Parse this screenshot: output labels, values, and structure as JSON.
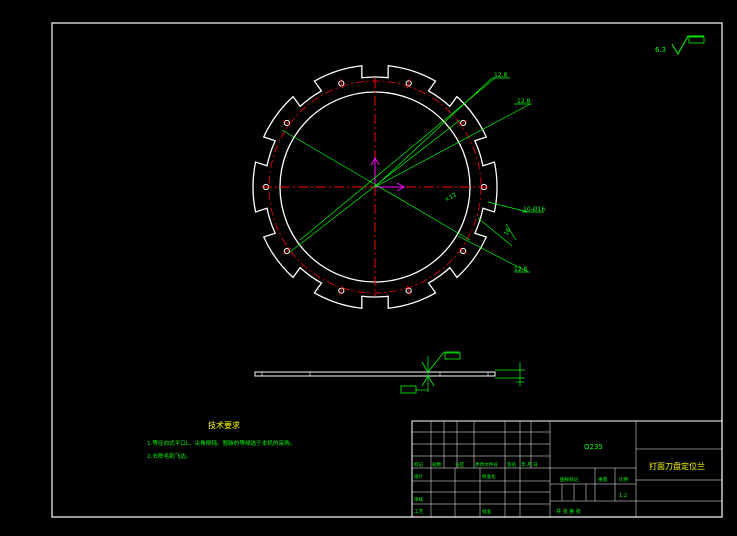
{
  "drawing": {
    "roughness_symbol": "6.3",
    "dimensions": {
      "r1": "12.8",
      "r2": "12.8",
      "r3": "12.8",
      "hole": "10-Ø16",
      "dia_small": "×12",
      "slot_width": "16"
    },
    "tech_requirements": {
      "title": "技术要求",
      "line1": "1.等径向式平口L、尖角倒钝。暂脉的等候选于本机的采购。",
      "line2": "2.去除毛刺飞边。"
    },
    "title_block": {
      "material": "Q235",
      "part_name": "打面刀盘定位兰",
      "scale_label": "比例",
      "scale_value": "1:2",
      "stage_label": "图样标记",
      "weight_label": "重量",
      "sheet_info": "共  张  第  张",
      "rev_headers": [
        "标记",
        "处数",
        "分区",
        "更改文件号",
        "签名",
        "年.月.日"
      ],
      "designer_label": "设计",
      "standard_label": "标准化",
      "reviewer_label": "审核",
      "process_label": "工艺",
      "approve_label": "批准"
    }
  },
  "colors": {
    "background": "#000000",
    "outline": "#ffffff",
    "dimension": "#00ff00",
    "centerline": "#ff0000",
    "axis": "#ff00ff"
  }
}
